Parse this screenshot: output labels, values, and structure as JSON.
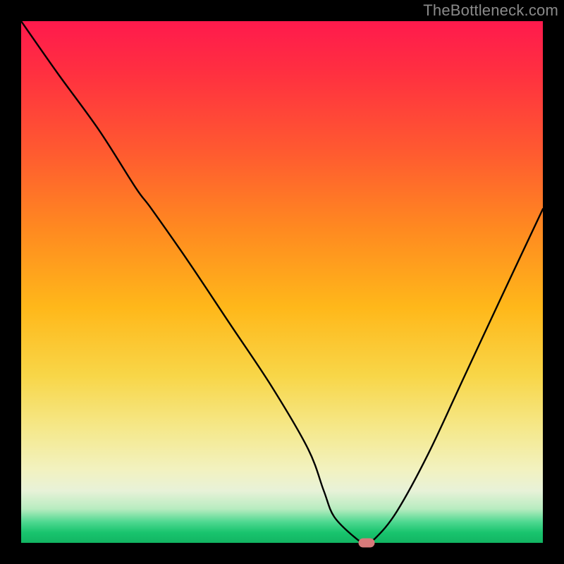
{
  "watermark": "TheBottleneck.com",
  "chart_data": {
    "type": "line",
    "title": "",
    "xlabel": "",
    "ylabel": "",
    "xlim": [
      0,
      100
    ],
    "ylim": [
      0,
      100
    ],
    "grid": false,
    "legend": false,
    "background": "vertical gradient red→orange→yellow→green",
    "series": [
      {
        "name": "bottleneck-curve",
        "x": [
          0,
          7,
          15,
          22,
          25,
          32,
          40,
          48,
          55,
          58,
          60,
          64,
          66,
          68,
          72,
          78,
          85,
          92,
          100
        ],
        "values": [
          100,
          90,
          79,
          68,
          64,
          54,
          42,
          30,
          18,
          10,
          5,
          1,
          0,
          1,
          6,
          17,
          32,
          47,
          64
        ]
      }
    ],
    "marker": {
      "x": 66.2,
      "y": 0,
      "color": "#d77a7a"
    }
  }
}
